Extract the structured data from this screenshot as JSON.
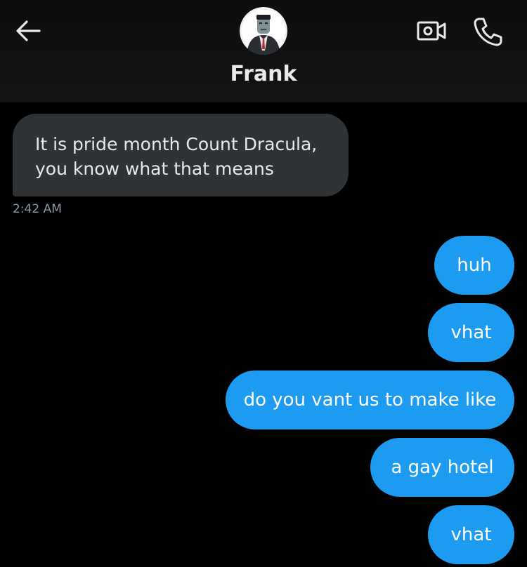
{
  "header": {
    "contact_name": "Frank"
  },
  "icons": {
    "back": "arrow-left-icon",
    "video": "video-camera-icon",
    "call": "phone-icon"
  },
  "colors": {
    "background": "#000000",
    "incoming_bubble": "#2f3336",
    "outgoing_bubble": "#1d9bf0",
    "timestamp": "#8b98a5"
  },
  "messages": {
    "incoming": [
      {
        "line1": "It is pride month Count Dracula,",
        "line2": "you know what that means",
        "time": "2:42 AM"
      }
    ],
    "outgoing": [
      {
        "text": "huh"
      },
      {
        "text": "vhat"
      },
      {
        "text": "do you vant us to make like"
      },
      {
        "text": "a gay hotel"
      },
      {
        "text": "vhat"
      }
    ]
  }
}
